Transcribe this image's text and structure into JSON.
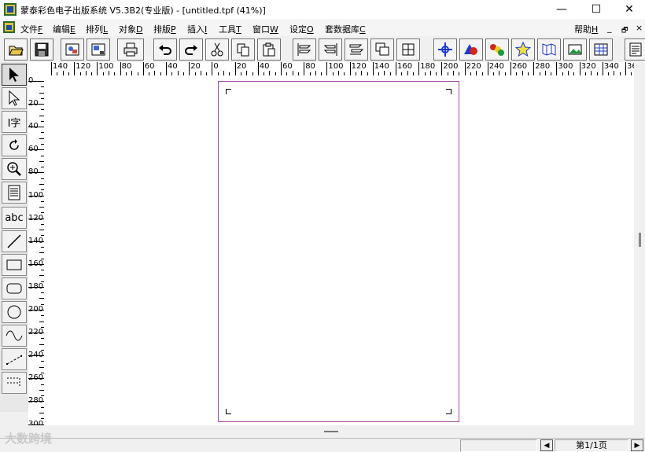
{
  "window": {
    "title": "蒙泰彩色电子出版系统 V5.3B2(专业版) - [untitled.tpf (41%)]",
    "min_glyph": "—",
    "max_glyph": "☐",
    "close_glyph": "✕"
  },
  "menubar": {
    "items": [
      {
        "label": "文件",
        "acc": "F"
      },
      {
        "label": "编辑",
        "acc": "E"
      },
      {
        "label": "排列",
        "acc": "L"
      },
      {
        "label": "对象",
        "acc": "D"
      },
      {
        "label": "排版",
        "acc": "P"
      },
      {
        "label": "插入",
        "acc": "I"
      },
      {
        "label": "工具",
        "acc": "T"
      },
      {
        "label": "窗口",
        "acc": "W"
      },
      {
        "label": "设定",
        "acc": "O"
      },
      {
        "label": "套数据库",
        "acc": "C"
      }
    ],
    "help": {
      "label": "帮助",
      "acc": "H"
    },
    "doc_min": "_",
    "doc_restore": "🗗",
    "doc_close": "×"
  },
  "toolbar": {
    "buttons": [
      "open-icon",
      "save-icon",
      "import-icon",
      "export-icon",
      "print-icon",
      "undo-icon",
      "redo-icon",
      "cut-icon",
      "copy-icon",
      "paste-icon",
      "align-left-icon",
      "align-right-icon",
      "distribute-icon",
      "front-icon",
      "group-icon",
      "move-icon",
      "shape-color-icon",
      "color-palette-icon",
      "star-icon",
      "map-icon",
      "image-icon",
      "table-icon",
      "text-block-icon"
    ]
  },
  "ruler": {
    "h_labels": [
      "140",
      "120",
      "100",
      "80",
      "60",
      "40",
      "20",
      "0",
      "20",
      "40",
      "60",
      "80",
      "100",
      "120",
      "140",
      "160",
      "180",
      "200",
      "220",
      "240",
      "260",
      "280",
      "300",
      "320",
      "340",
      "36"
    ],
    "v_labels": [
      "0",
      "20",
      "40",
      "60",
      "80",
      "100",
      "120",
      "140",
      "160",
      "180",
      "200",
      "220",
      "240",
      "260",
      "280",
      "300"
    ]
  },
  "tools": [
    "pointer-tool",
    "node-select-tool",
    "text-tool",
    "rotate-tool",
    "zoom-tool",
    "text-box-tool",
    "abc-tool",
    "line-tool",
    "rectangle-tool",
    "rounded-rect-tool",
    "ellipse-tool",
    "curve-tool",
    "polyline-tool",
    "table-tool"
  ],
  "tool_labels": {
    "text_tool": "I字",
    "abc": "abc"
  },
  "status": {
    "page": "第1/1页",
    "prev": "◀",
    "next": "▶",
    "watermark": "大数跨境"
  },
  "colors": {
    "page_border": "#a04ca0",
    "canvas": "#ffffff",
    "chrome": "#f0f0f0"
  }
}
